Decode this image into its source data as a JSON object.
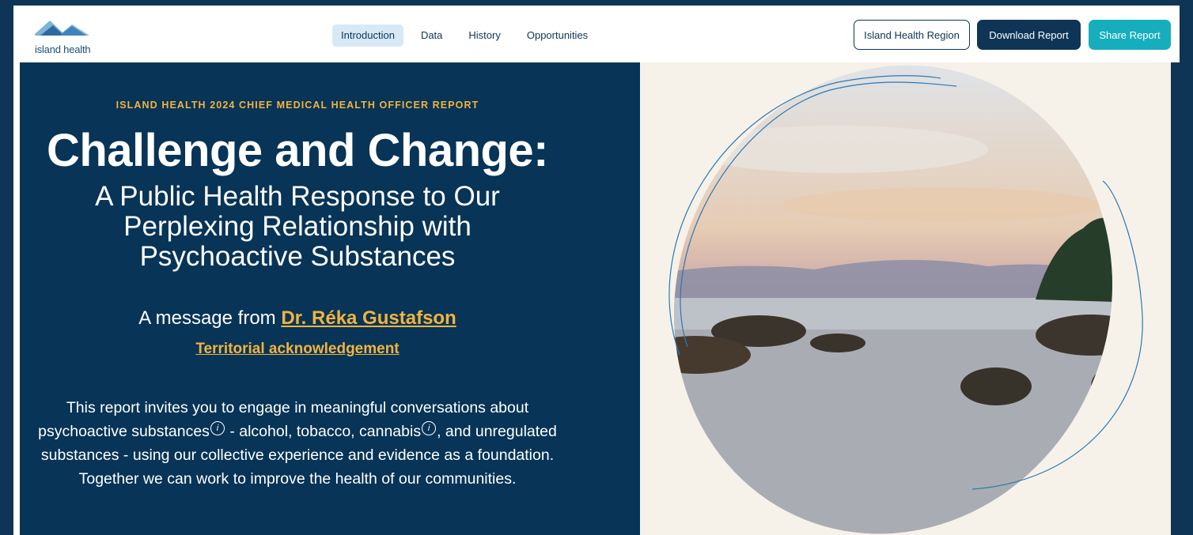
{
  "nav": {
    "logo_text": "island health",
    "tabs": [
      "Introduction",
      "Data",
      "History",
      "Opportunities"
    ],
    "active_tab": "Introduction",
    "region_button": "Island Health Region",
    "download_button": "Download Report",
    "share_button": "Share Report"
  },
  "hero": {
    "kicker": "ISLAND HEALTH 2024 CHIEF MEDICAL HEALTH OFFICER REPORT",
    "title": "Challenge and Change:",
    "subtitle_lines": [
      "A Public Health Response to Our",
      "Perplexing Relationship with",
      "Psychoactive Substances"
    ],
    "message_prefix": "A message from ",
    "message_link": "Dr. Réka Gustafson",
    "acknowledgement_link": "Territorial acknowledgement",
    "body": {
      "part1": "This report invites you to engage in meaningful conversations about psychoactive substances",
      "part2": " - alcohol, tobacco, cannabis",
      "part3": ", and unregulated substances - using our collective experience and evidence as a foundation. Together we can work to improve the health of our communities."
    },
    "info_glyph": "i"
  },
  "colors": {
    "navy": "#0e3556",
    "hero_bg": "#073457",
    "accent_gold": "#f3b33d",
    "teal": "#16aebd",
    "tab_active_bg": "#d7e9f6",
    "cream": "#f6f2e9"
  },
  "icons": [
    "mountain-logo-icon",
    "info-icon"
  ]
}
